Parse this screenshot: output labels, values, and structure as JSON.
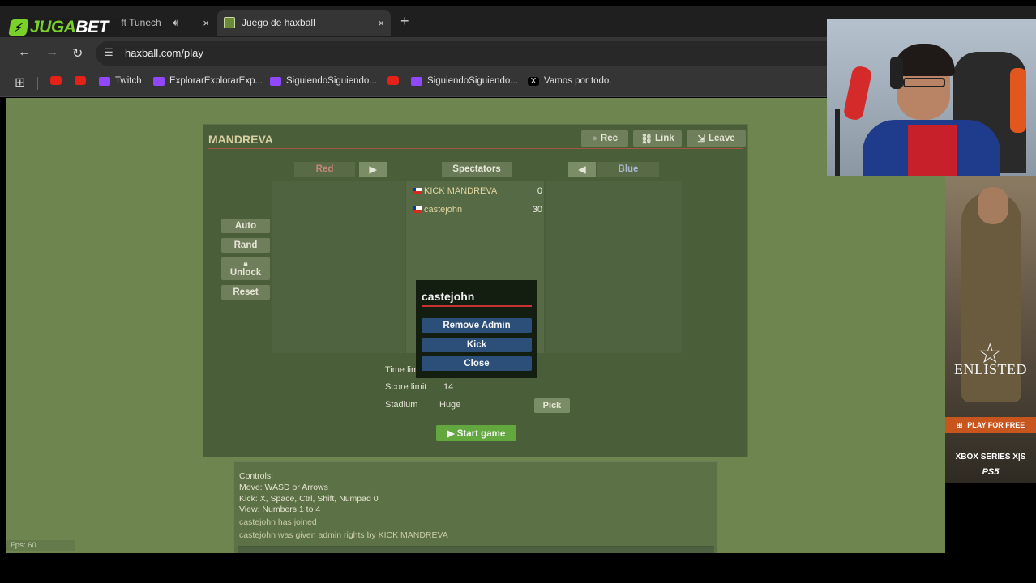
{
  "browser": {
    "tabs": [
      {
        "label": "s ft Tunech",
        "active": false
      },
      {
        "label": "Juego de haxball",
        "active": true
      }
    ],
    "new_tab_icon": "+",
    "close_icon": "×",
    "url": "haxball.com/play",
    "bookmarks": [
      {
        "icon": "youtube",
        "label": ""
      },
      {
        "icon": "youtube",
        "label": ""
      },
      {
        "icon": "twitch",
        "label": "Twitch"
      },
      {
        "icon": "twitch",
        "label": "ExplorarExplorarExp..."
      },
      {
        "icon": "twitch",
        "label": "SiguiendoSiguiendo..."
      },
      {
        "icon": "youtube",
        "label": ""
      },
      {
        "icon": "twitch",
        "label": "SiguiendoSiguiendo..."
      },
      {
        "icon": "x",
        "label": "Vamos por todo."
      }
    ]
  },
  "overlay": {
    "sponsor_logo_a": "JUGA",
    "sponsor_logo_b": "BET"
  },
  "room": {
    "name": "MANDREVA",
    "rec_label": "Rec",
    "link_label": "Link",
    "leave_label": "Leave",
    "teams": {
      "red_label": "Red",
      "spectators_label": "Spectators",
      "blue_label": "Blue",
      "move_right": "▶",
      "move_left": "◀"
    },
    "spectators": [
      {
        "name": "KICK MANDREVA",
        "ping": "0"
      },
      {
        "name": "castejohn",
        "ping": "30"
      }
    ],
    "admin_buttons": {
      "auto": "Auto",
      "rand": "Rand",
      "unlock": "Unlock",
      "reset": "Reset"
    },
    "settings": {
      "time_limit_label": "Time lim",
      "score_limit_label": "Score limit",
      "score_limit_value": "14",
      "stadium_label": "Stadium",
      "stadium_value": "Huge",
      "pick_label": "Pick"
    },
    "start_label": "▶ Start game"
  },
  "popup": {
    "title": "castejohn",
    "remove_admin": "Remove Admin",
    "kick": "Kick",
    "close": "Close"
  },
  "chat": {
    "lines": [
      "Controls:",
      "Move: WASD or Arrows",
      "Kick: X, Space, Ctrl, Shift, Numpad 0",
      "View: Numbers 1 to 4",
      "castejohn has joined",
      "castejohn was given admin rights by KICK MANDREVA"
    ]
  },
  "fps": "Fps: 60",
  "ad": {
    "brand": "ENLISTED",
    "cta": "PLAY FOR FREE",
    "platform1": "XBOX SERIES X|S",
    "platform2": "PS5"
  },
  "colors": {
    "page_bg": "#6f8550",
    "room_bg": "#4b5e3a",
    "popup_bg": "#141e10",
    "popup_btn": "#2c4f7a",
    "start_btn": "#62a83e"
  }
}
